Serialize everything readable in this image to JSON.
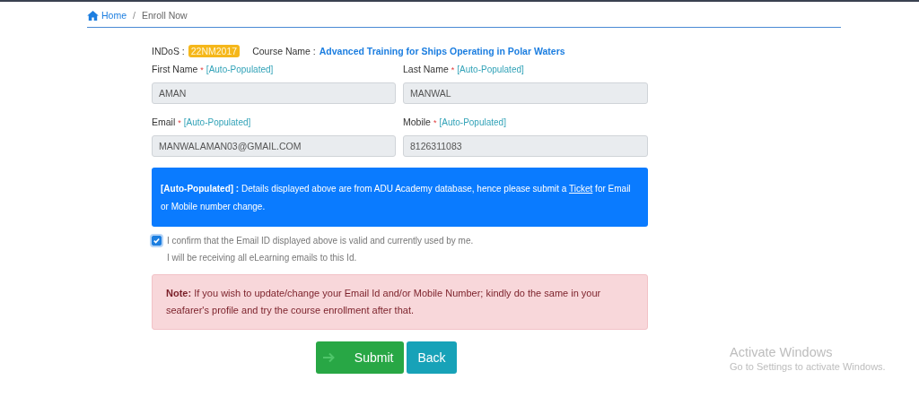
{
  "breadcrumb": [
    {
      "label": "Home",
      "kind": "link"
    },
    {
      "label": "Enroll Now",
      "kind": "current"
    }
  ],
  "breadcrumb_separator": "/",
  "course": {
    "indos_label": "INDoS :",
    "indos": "22NM2017",
    "name_label": "Course Name :",
    "name": "Advanced Training for Ships Operating in Polar Waters"
  },
  "fields": [
    {
      "label": "First Name",
      "required": true,
      "hint": "[Auto-Populated]",
      "value": "AMAN"
    },
    {
      "label": "Last Name",
      "required": true,
      "hint": "[Auto-Populated]",
      "value": "MANWAL"
    },
    {
      "label": "Email",
      "required": true,
      "hint": "[Auto-Populated]",
      "value": "MANWALAMAN03@GMAIL.COM"
    },
    {
      "label": "Mobile",
      "required": true,
      "hint": "[Auto-Populated]",
      "value": "8126311083"
    }
  ],
  "required_mark": "*",
  "info": {
    "before": "**[Auto-Populated] :** Details displayed above are from ADU Academy database, hence please submit a",
    "link": "Ticket",
    "after": "for Email or Mobile number change."
  },
  "confirm": {
    "checked": true,
    "lines": [
      "I confirm that the Email ID displayed above is valid and currently used by me.",
      "I will be receiving all eLearning emails to this Id."
    ]
  },
  "note": "**Note:** If you wish to update/change your Email Id and/or Mobile Number; kindly do the same in your seafarer's profile and try the course enrollment after that.",
  "buttons": [
    {
      "label": "Submit",
      "kind": "submit"
    },
    {
      "label": "Back",
      "kind": "back"
    }
  ],
  "os_overlay": {
    "title": "Activate Windows",
    "text": "Go to Settings to activate Windows."
  }
}
